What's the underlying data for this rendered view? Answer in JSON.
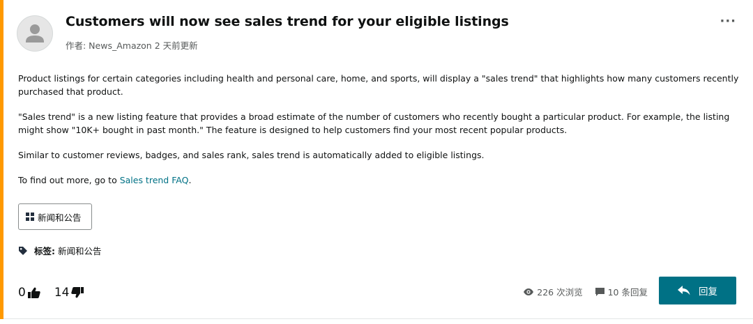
{
  "post": {
    "title": "Customers will now see sales trend for your eligible listings",
    "meta": "作者: News_Amazon 2 天前更新",
    "paragraphs": [
      "Product listings for certain categories including health and personal care, home, and sports, will display a \"sales trend\" that highlights how many customers recently purchased that product.",
      "\"Sales trend\" is a new listing feature that provides a broad estimate of the number of customers who recently bought a particular product. For example, the listing might show \"10K+ bought in past month.\" The feature is designed to help customers find your most recent popular products.",
      "Similar to customer reviews, badges, and sales rank, sales trend is automatically added to eligible listings."
    ],
    "find_more_prefix": "To find out more, go to ",
    "find_more_link": "Sales trend FAQ",
    "find_more_suffix": ".",
    "board": "新闻和公告",
    "tags_label": "标签:",
    "tags_value": "新闻和公告",
    "more_menu": "···"
  },
  "footer": {
    "upvotes": "0",
    "downvotes": "14",
    "views": "226 次浏览",
    "replies": "10 条回复",
    "reply_button": "回复"
  },
  "colors": {
    "accent": "#ff9900",
    "link": "#007185",
    "reply_button": "#007185"
  },
  "icons": [
    "user-avatar-icon",
    "more-icon",
    "board-grid-icon",
    "tag-icon",
    "thumbs-up-icon",
    "thumbs-down-icon",
    "eye-icon",
    "comment-icon",
    "reply-arrow-icon"
  ]
}
